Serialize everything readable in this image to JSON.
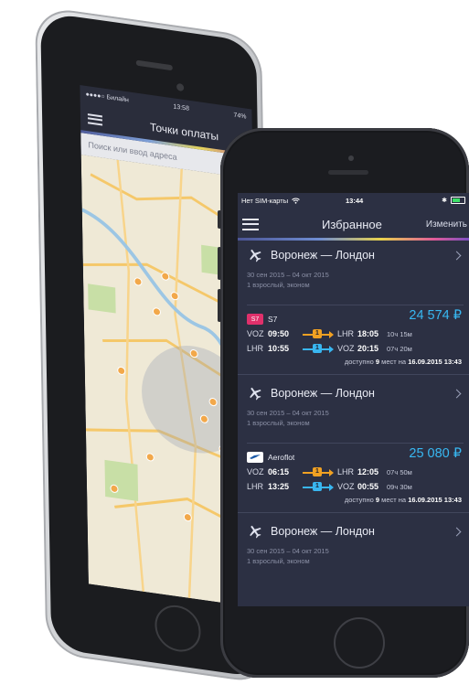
{
  "back_phone": {
    "status": {
      "carrier": "●●●●○ Билайн",
      "time": "13:58",
      "battery": "74%"
    },
    "title": "Точки оплаты",
    "search_placeholder": "Поиск или ввод адреса"
  },
  "status": {
    "carrier": "Нет SIM-карты",
    "time": "13:44"
  },
  "navbar": {
    "title": "Избранное",
    "edit_label": "Изменить"
  },
  "routes": [
    {
      "title": "Воронеж — Лондон",
      "dates": "30 сен 2015 – 04 окт 2015",
      "passengers": "1 взрослый, эконом",
      "offer": {
        "airline": "S7",
        "logo_text": "S7",
        "logo_color": "#e0306b",
        "price": "24 574 ₽",
        "legs": [
          {
            "from": "VOZ",
            "dep": "09:50",
            "stops": "1",
            "to": "LHR",
            "arr": "18:05",
            "dur": "10ч 15м",
            "color": "orange"
          },
          {
            "from": "LHR",
            "dep": "10:55",
            "stops": "1",
            "to": "VOZ",
            "arr": "20:15",
            "dur": "07ч 20м",
            "color": "blue"
          }
        ],
        "avail_prefix": "доступно",
        "avail_count": "9",
        "avail_mid": "мест на",
        "avail_date": "16.09.2015 13:43"
      }
    },
    {
      "title": "Воронеж — Лондон",
      "dates": "30 сен 2015 – 04 окт 2015",
      "passengers": "1 взрослый, эконом",
      "offer": {
        "airline": "Aeroflot",
        "logo_text": "",
        "logo_color": "#ffffff",
        "price": "25 080 ₽",
        "legs": [
          {
            "from": "VOZ",
            "dep": "06:15",
            "stops": "1",
            "to": "LHR",
            "arr": "12:05",
            "dur": "07ч 50м",
            "color": "orange"
          },
          {
            "from": "LHR",
            "dep": "13:25",
            "stops": "1",
            "to": "VOZ",
            "arr": "00:55",
            "dur": "09ч 30м",
            "color": "blue"
          }
        ],
        "avail_prefix": "доступно",
        "avail_count": "9",
        "avail_mid": "мест на",
        "avail_date": "16.09.2015 13:43"
      }
    },
    {
      "title": "Воронеж — Лондон",
      "dates": "30 сен 2015 – 04 окт 2015",
      "passengers": "1 взрослый, эконом"
    }
  ],
  "colors": {
    "accent_price": "#38b8f2",
    "screen_bg": "#2c3043",
    "stop_orange": "#f1a122",
    "stop_blue": "#39b6f0"
  }
}
